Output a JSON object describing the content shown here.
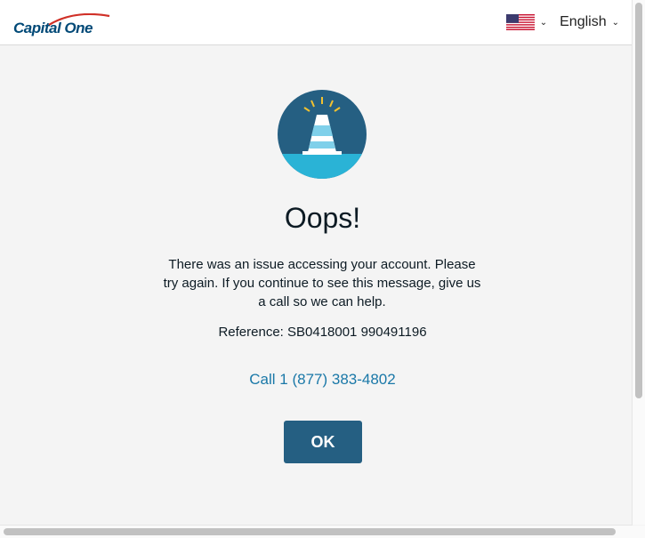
{
  "header": {
    "logo_text": "Capital One",
    "language": {
      "flag_icon": "us-flag-icon",
      "label": "English"
    }
  },
  "error": {
    "icon": "traffic-cone-icon",
    "title": "Oops!",
    "message": "There was an issue accessing your account. Please try again. If you continue to see this message, give us a call so we can help.",
    "reference": "Reference: SB0418001 990491196",
    "call_link": "Call 1 (877) 383-4802",
    "ok_label": "OK"
  },
  "colors": {
    "brand": "#004977",
    "accent_red": "#d03027",
    "button": "#255f82",
    "link": "#1a78a8",
    "background": "#f4f4f4"
  }
}
